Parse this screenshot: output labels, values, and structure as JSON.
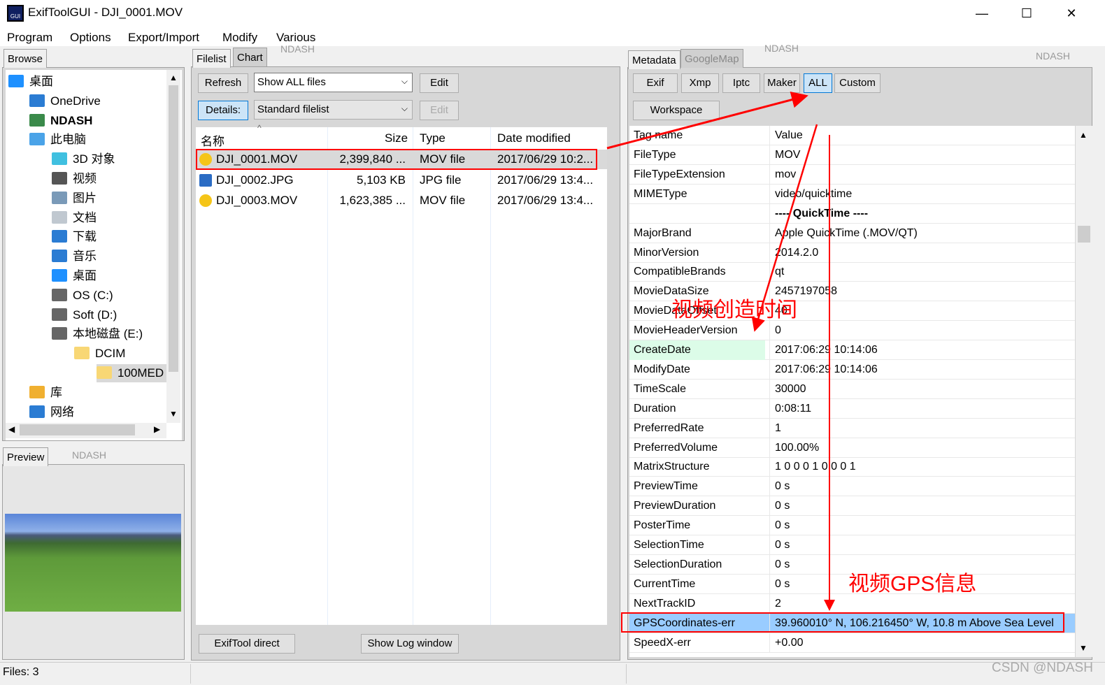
{
  "window": {
    "title": "ExifToolGUI - DJI_0001.MOV",
    "icon_text": "GUI",
    "minimize": "—",
    "maximize": "☐",
    "close": "✕"
  },
  "menu": [
    "Program",
    "Options",
    "Export/Import",
    "Modify",
    "Various"
  ],
  "watermarks": {
    "text": "NDASH",
    "footer": "CSDN @NDASH"
  },
  "left": {
    "browse_tab": "Browse",
    "tree": [
      {
        "label": "桌面",
        "icon": "desktop-icon",
        "color": "#1e90ff",
        "level": 0
      },
      {
        "label": "OneDrive",
        "icon": "cloud-icon",
        "color": "#2b7cd3",
        "level": 1
      },
      {
        "label": "NDASH",
        "icon": "user-icon",
        "color": "#3a8a4a",
        "level": 1
      },
      {
        "label": "此电脑",
        "icon": "computer-icon",
        "color": "#4aa3e8",
        "level": 1
      },
      {
        "label": "3D 对象",
        "icon": "cube-icon",
        "color": "#40c0e0",
        "level": 2
      },
      {
        "label": "视频",
        "icon": "film-icon",
        "color": "#555555",
        "level": 2
      },
      {
        "label": "图片",
        "icon": "picture-icon",
        "color": "#7a9ab8",
        "level": 2
      },
      {
        "label": "文档",
        "icon": "document-icon",
        "color": "#c0c8d0",
        "level": 2
      },
      {
        "label": "下载",
        "icon": "download-icon",
        "color": "#2b7cd3",
        "level": 2
      },
      {
        "label": "音乐",
        "icon": "music-icon",
        "color": "#2b7cd3",
        "level": 2
      },
      {
        "label": "桌面",
        "icon": "desktop-icon",
        "color": "#1e90ff",
        "level": 2
      },
      {
        "label": "OS (C:)",
        "icon": "drive-icon",
        "color": "#666666",
        "level": 2
      },
      {
        "label": "Soft (D:)",
        "icon": "drive-icon",
        "color": "#666666",
        "level": 2
      },
      {
        "label": "本地磁盘 (E:)",
        "icon": "drive-icon",
        "color": "#666666",
        "level": 2
      },
      {
        "label": "DCIM",
        "icon": "folder-icon",
        "color": "#f8d775",
        "level": 3
      },
      {
        "label": "100MED",
        "icon": "folder-icon",
        "color": "#f8d775",
        "level": 4,
        "selected": true
      },
      {
        "label": "库",
        "icon": "library-icon",
        "color": "#f0b030",
        "level": 1
      },
      {
        "label": "网络",
        "icon": "network-icon",
        "color": "#2b7cd3",
        "level": 1
      }
    ],
    "preview_tab": "Preview"
  },
  "middle": {
    "tabs": [
      "Filelist",
      "Chart"
    ],
    "refresh": "Refresh",
    "filter": "Show ALL files",
    "edit": "Edit",
    "details": "Details:",
    "view": "Standard filelist",
    "edit2": "Edit",
    "columns": [
      "名称",
      "Size",
      "Type",
      "Date modified"
    ],
    "files": [
      {
        "name": "DJI_0001.MOV",
        "size": "2,399,840 ...",
        "type": "MOV file",
        "date": "2017/06/29 10:2...",
        "icon": "video-file-icon",
        "selected": true
      },
      {
        "name": "DJI_0002.JPG",
        "size": "5,103 KB",
        "type": "JPG file",
        "date": "2017/06/29 13:4...",
        "icon": "image-file-icon"
      },
      {
        "name": "DJI_0003.MOV",
        "size": "1,623,385 ...",
        "type": "MOV file",
        "date": "2017/06/29 13:4...",
        "icon": "video-file-icon"
      }
    ],
    "exiftool_direct": "ExifTool direct",
    "show_log": "Show Log window"
  },
  "right": {
    "tabs": [
      "Metadata",
      "GoogleMap"
    ],
    "buttons": [
      "Exif",
      "Xmp",
      "Iptc",
      "Maker",
      "ALL",
      "Custom"
    ],
    "active_button": "ALL",
    "workspace": "Workspace",
    "columns": [
      "Tag name",
      "Value"
    ],
    "rows": [
      [
        "FileType",
        "MOV"
      ],
      [
        "FileTypeExtension",
        "mov"
      ],
      [
        "MIMEType",
        "video/quicktime"
      ],
      [
        "",
        "---- QuickTime ----"
      ],
      [
        "MajorBrand",
        "Apple QuickTime (.MOV/QT)"
      ],
      [
        "MinorVersion",
        "2014.2.0"
      ],
      [
        "CompatibleBrands",
        "qt"
      ],
      [
        "MovieDataSize",
        "2457197058"
      ],
      [
        "MovieDataOffset",
        "40"
      ],
      [
        "MovieHeaderVersion",
        "0"
      ],
      [
        "CreateDate",
        "2017:06:29 10:14:06"
      ],
      [
        "ModifyDate",
        "2017:06:29 10:14:06"
      ],
      [
        "TimeScale",
        "30000"
      ],
      [
        "Duration",
        "0:08:11"
      ],
      [
        "PreferredRate",
        "1"
      ],
      [
        "PreferredVolume",
        "100.00%"
      ],
      [
        "MatrixStructure",
        "1 0 0 0 1 0 0 0 1"
      ],
      [
        "PreviewTime",
        "0 s"
      ],
      [
        "PreviewDuration",
        "0 s"
      ],
      [
        "PosterTime",
        "0 s"
      ],
      [
        "SelectionTime",
        "0 s"
      ],
      [
        "SelectionDuration",
        "0 s"
      ],
      [
        "CurrentTime",
        "0 s"
      ],
      [
        "NextTrackID",
        "2"
      ],
      [
        "GPSCoordinates-err",
        "39.960010° N, 106.216450° W, 10.8 m Above Sea Level"
      ],
      [
        "SpeedX-err",
        "+0.00"
      ]
    ],
    "highlight_row": "CreateDate",
    "selected_row": "GPSCoordinates-err"
  },
  "annotations": {
    "create_time": "视频创造时间",
    "gps_info": "视频GPS信息",
    "color": "#ff0000"
  },
  "status": {
    "files": "Files: 3"
  }
}
